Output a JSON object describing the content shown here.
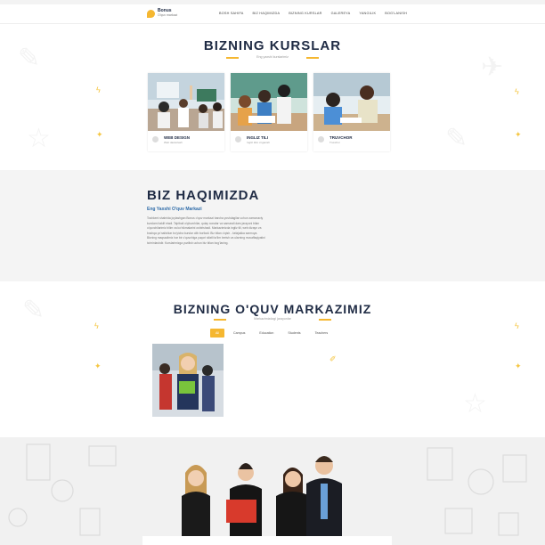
{
  "header": {
    "logo_name": "Bonus",
    "logo_sub": "O'quv markazi",
    "nav": [
      "BOSH SAHIFA",
      "BIZ HAQIMIZDA",
      "BIZNING KURSLAR",
      "GALEREYA",
      "YANGILIK",
      "BOG'LANISH"
    ]
  },
  "courses": {
    "title": "BIZNING KURSLAR",
    "subtitle": "Eng yaxshi kurslarimiz",
    "items": [
      {
        "name": "WEB DESIGN",
        "desc": "Web dasturlash"
      },
      {
        "name": "INGLIZ TILI",
        "desc": "Ingliz tilini o'rganish"
      },
      {
        "name": "TRUVCHOR",
        "desc": "Truvchor"
      }
    ]
  },
  "about": {
    "title": "BIZ HAQIMIZDA",
    "subtitle": "Eng Yaxshi O'quv Markazi",
    "text": "Toshkent shahrida joylashgan Bonus o'quv markazi barcha yoshdagilar uchun zamonaviy kurslarni taklif etadi. Tajribali o'qituvchilar, qulay xonalar va samarali dars jarayoni bilan o'quvchilarimiz bilim va ko'nikmalarini oshirishadi. Markazimizda ingliz tili, web dizayn va boshqa yo'nalishlar bo'yicha kurslar olib boriladi. Biz bilan o'qish - kelajakka sarmoya. Bizning maqsadimiz har bir o'quvchiga yuqori sifatli ta'lim berish va ularning muvaffaqiyatini ta'minlashdir. Kurslarimizga yozilish uchun biz bilan bog'laning."
  },
  "markaz": {
    "title": "BIZNING O'QUV MARKAZIMIZ",
    "subtitle": "Markazimizdagi jarayonlar",
    "tabs": [
      "All",
      "Campus",
      "Education",
      "Students",
      "Teachers"
    ],
    "active_tab": 0
  },
  "colors": {
    "accent": "#f5b731",
    "dark": "#1f2b44"
  }
}
